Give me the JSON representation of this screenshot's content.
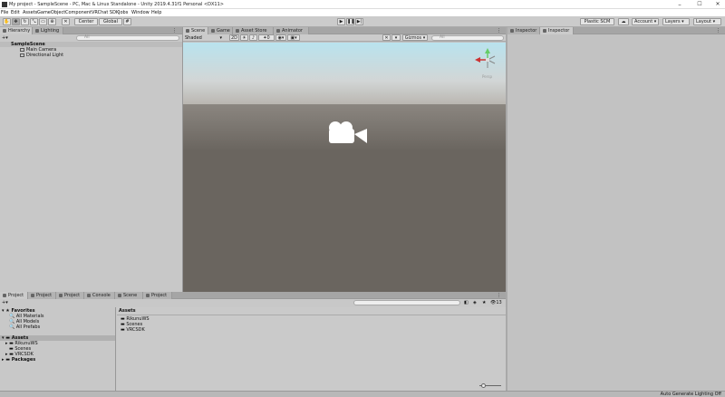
{
  "window": {
    "title": "My project - SampleScene - PC, Mac & Linux Standalone - Unity 2019.4.31f1 Personal <DX11>",
    "controls": [
      "–",
      "☐",
      "✕"
    ]
  },
  "menu": [
    "File",
    "Edit",
    "Assets",
    "GameObject",
    "Component",
    "VRChat SDK",
    "Jobs",
    "Window",
    "Help"
  ],
  "toolbar": {
    "pivot": "Center",
    "space": "Global",
    "plastic_scm": "Plastic SCM",
    "account": "Account",
    "layers": "Layers",
    "layout": "Layout"
  },
  "hierarchy": {
    "tabs": [
      "Hierarchy",
      "Lighting"
    ],
    "search_placeholder": "All",
    "scene_name": "SampleScene",
    "items": [
      "Main Camera",
      "Directional Light"
    ]
  },
  "scene": {
    "tabs": [
      "Scene",
      "Game",
      "Asset Store",
      "Animator"
    ],
    "shading_mode": "Shaded",
    "mode_2d": "2D",
    "effects_count": "0",
    "gizmos": "Gizmos",
    "search_placeholder": "All",
    "gizmo_label": "Persp",
    "colors": {
      "sky_top": "#b9e3ee",
      "sky_bottom": "#d2d6d6",
      "ground": "#6a655f"
    }
  },
  "inspector": {
    "tabs": [
      "Inspector",
      "Inspector"
    ]
  },
  "project": {
    "tabs": [
      "Project",
      "Project",
      "Project",
      "Console",
      "Scene",
      "Project"
    ],
    "hidden_count": "13",
    "favorites_label": "Favorites",
    "favorites": [
      "All Materials",
      "All Models",
      "All Prefabs"
    ],
    "assets_label": "Assets",
    "asset_folders": [
      "RikunuWS",
      "Scenes",
      "VRCSDK"
    ],
    "packages_label": "Packages",
    "breadcrumb": "Assets",
    "grid_items": [
      "RikunuWS",
      "Scenes",
      "VRCSDK"
    ]
  },
  "status": {
    "lighting": "Auto Generate Lighting Off"
  }
}
